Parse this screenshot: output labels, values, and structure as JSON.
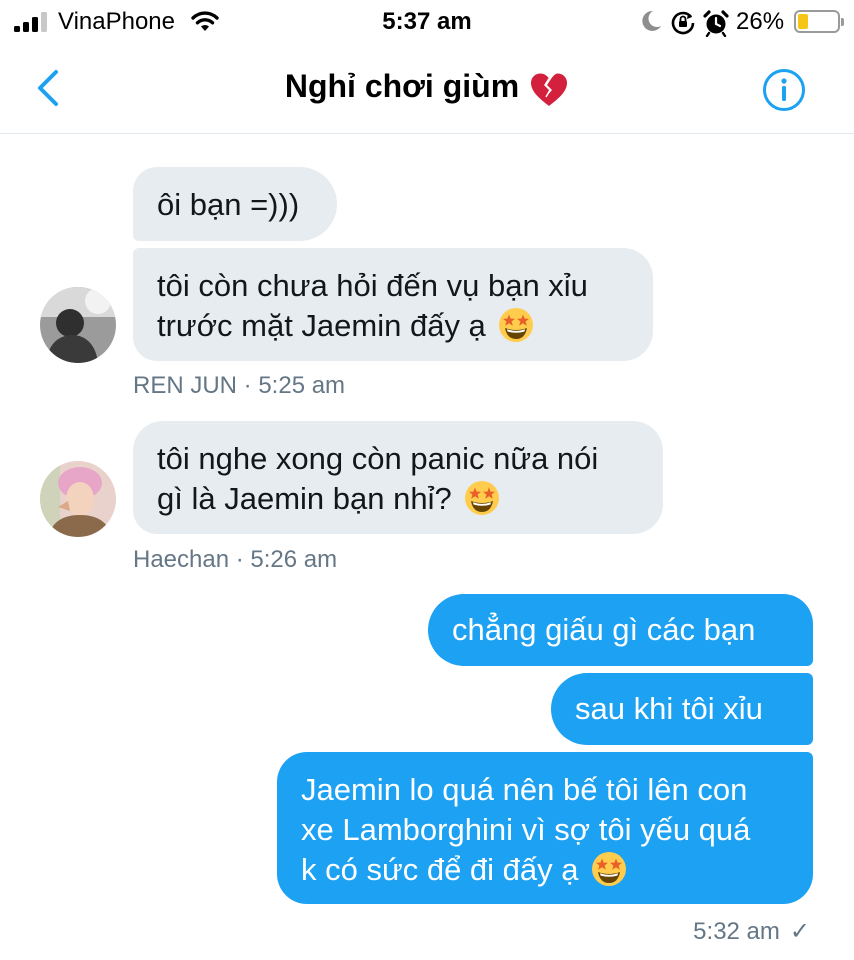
{
  "status_bar": {
    "carrier": "VinaPhone",
    "time": "5:37 am",
    "battery_percent": "26%",
    "battery_level": 0.26,
    "icons": [
      "signal-icon",
      "wifi-icon",
      "moon-icon",
      "rotation-lock-icon",
      "alarm-icon",
      "battery-icon"
    ]
  },
  "header": {
    "title": "Nghỉ chơi giùm",
    "title_emoji": "broken-heart-icon",
    "back_icon": "chevron-left-icon",
    "info_icon": "info-icon"
  },
  "messages": [
    {
      "direction": "incoming",
      "lines": [
        "ôi bạn =)))"
      ]
    },
    {
      "direction": "incoming",
      "lines": [
        "tôi còn chưa hỏi đến vụ bạn xỉu",
        "trước mặt Jaemin đấy ạ"
      ],
      "emoji": "star-struck-icon"
    },
    {
      "meta": "REN JUN · 5:25 am"
    },
    {
      "direction": "incoming",
      "lines": [
        "tôi nghe xong còn panic nữa nói",
        "gì là Jaemin bạn nhỉ?"
      ],
      "emoji": "star-struck-icon"
    },
    {
      "meta": "Haechan · 5:26 am"
    },
    {
      "direction": "outgoing",
      "lines": [
        "chẳng giấu gì các bạn"
      ]
    },
    {
      "direction": "outgoing",
      "lines": [
        "sau khi tôi xỉu"
      ]
    },
    {
      "direction": "outgoing",
      "lines": [
        "Jaemin lo quá nên bế tôi lên con",
        "xe Lamborghini vì sợ tôi yếu quá",
        "k có sức để đi đấy ạ"
      ],
      "emoji": "star-struck-icon"
    },
    {
      "meta": "5:32 am",
      "read_receipt": "✓"
    }
  ],
  "colors": {
    "accent": "#1da1f2",
    "incoming_bubble": "#e6ecf0",
    "meta_text": "#657786"
  }
}
